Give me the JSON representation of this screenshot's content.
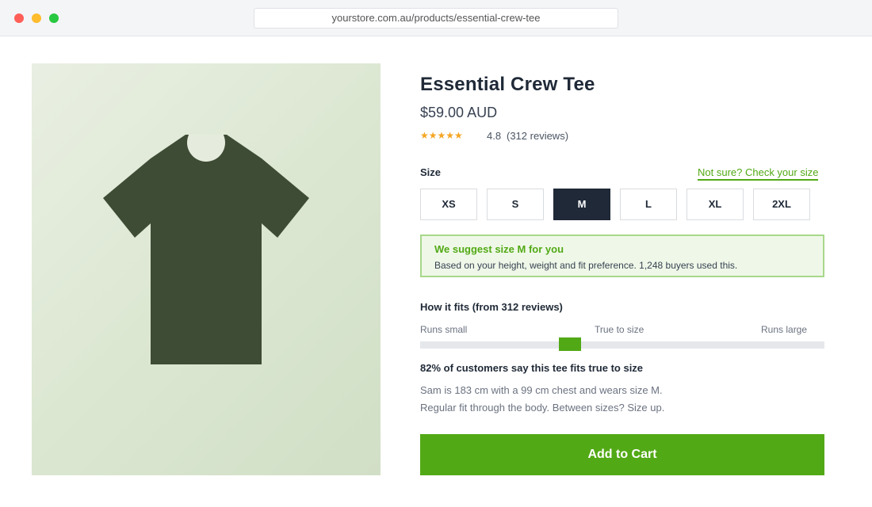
{
  "browser": {
    "url": "yourstore.com.au/products/essential-crew-tee"
  },
  "product": {
    "title": "Essential Crew Tee",
    "price": "$59.00 AUD",
    "stars": "★★★★★",
    "rating": "4.8",
    "review_count": "(312 reviews)",
    "image_icon": "t-shirt-icon",
    "image_color": "#3f4c35"
  },
  "size": {
    "label": "Size",
    "guide_link": "Not sure? Check your size",
    "options": [
      "XS",
      "S",
      "M",
      "L",
      "XL",
      "2XL"
    ],
    "selected": "M"
  },
  "suggestion": {
    "title": "We suggest size M for you",
    "subtitle": "Based on your height, weight and fit preference. 1,248 buyers used this."
  },
  "fit": {
    "heading": "How it fits (from 312 reviews)",
    "scale_left": "Runs small",
    "scale_center": "True to size",
    "scale_right": "Runs large",
    "marker_position": 0.37,
    "stat": "82% of customers say this tee fits true to size",
    "note_line1": "Sam is 183 cm with a 99 cm chest and wears size M.",
    "note_line2": "Regular fit through the body. Between sizes? Size up."
  },
  "cart": {
    "label": "Add to Cart"
  },
  "colors": {
    "accent": "#52a916",
    "dark": "#1f2937"
  }
}
